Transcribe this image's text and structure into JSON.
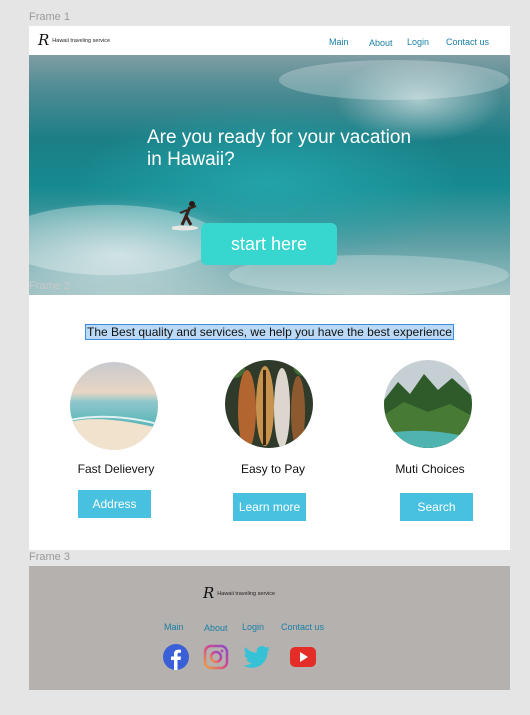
{
  "frames": {
    "frame1_label": "Frame 1",
    "frame2_label": "Frame 2",
    "frame3_label": "Frame 3"
  },
  "header": {
    "logo_mark": "R",
    "logo_text": "Hawaii traveling service",
    "nav": [
      "Main",
      "About",
      "Login",
      "Contact us"
    ]
  },
  "hero": {
    "title_line1": "Are you ready for your vacation",
    "title_line2": "in Hawaii?",
    "cta_label": "start here"
  },
  "services": {
    "tagline": "The Best quality and services, we help you have the best experience",
    "features": [
      {
        "title": "Fast Delievery",
        "button": "Address",
        "image": "beach-photo"
      },
      {
        "title": "Easy to Pay",
        "button": "Learn more",
        "image": "surfboards-photo"
      },
      {
        "title": "Muti Choices",
        "button": "Search",
        "image": "green-mountains-photo"
      }
    ]
  },
  "footer": {
    "logo_mark": "R",
    "logo_text": "Hawaii traveling service",
    "nav": [
      "Main",
      "About",
      "Login",
      "Contact us"
    ],
    "social_icons": [
      "facebook-icon",
      "instagram-icon",
      "twitter-icon",
      "youtube-icon"
    ]
  },
  "colors": {
    "link": "#1a7fa6",
    "cta": "#37d6cf",
    "feature_button": "#48c1e0",
    "footer_bg": "#b5b1af",
    "selection_highlight": "#b9d9f5"
  }
}
